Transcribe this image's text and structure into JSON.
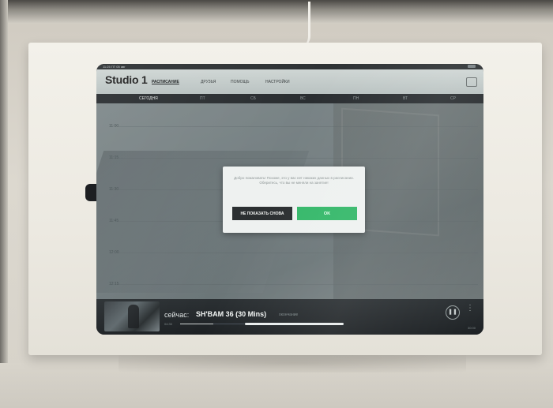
{
  "status_bar": {
    "time": "11:25  ПТ 05 авг"
  },
  "app": {
    "title": "Studio 1",
    "nav": [
      {
        "label": "РАСПИСАНИЕ",
        "active": true
      },
      {
        "label": "ДРУЗЬЯ",
        "active": false
      },
      {
        "label": "ПОМОЩЬ",
        "active": false
      },
      {
        "label": "НАСТРОЙКИ",
        "active": false
      }
    ]
  },
  "days": [
    "СЕГОДНЯ",
    "ПТ",
    "СБ",
    "ВС",
    "ПН",
    "ВТ",
    "СР"
  ],
  "timeline": {
    "times": [
      "11:00",
      "11:15",
      "11:30",
      "11:45",
      "12:00",
      "12:15"
    ]
  },
  "dialog": {
    "message": "Добро пожаловать! Похоже, это у вас нет никаких данных в расписании. Оберитесь, что вы не меняли на занятие!",
    "dismiss_label": "НЕ ПОКАЗАТЬ СНОВА",
    "ok_label": "OK"
  },
  "player": {
    "now_label": "сейчас:",
    "track": "SH'BAM 36 (30 Mins)",
    "extra": "окончание",
    "elapsed": "04:30",
    "duration": "30:00",
    "progress": 0.38,
    "pause_icon": "pause-icon",
    "more_icon": "more-vertical-icon"
  },
  "colors": {
    "accent": "#35b86a",
    "dark": "#2b2f31",
    "enclosure": "#efede6"
  }
}
